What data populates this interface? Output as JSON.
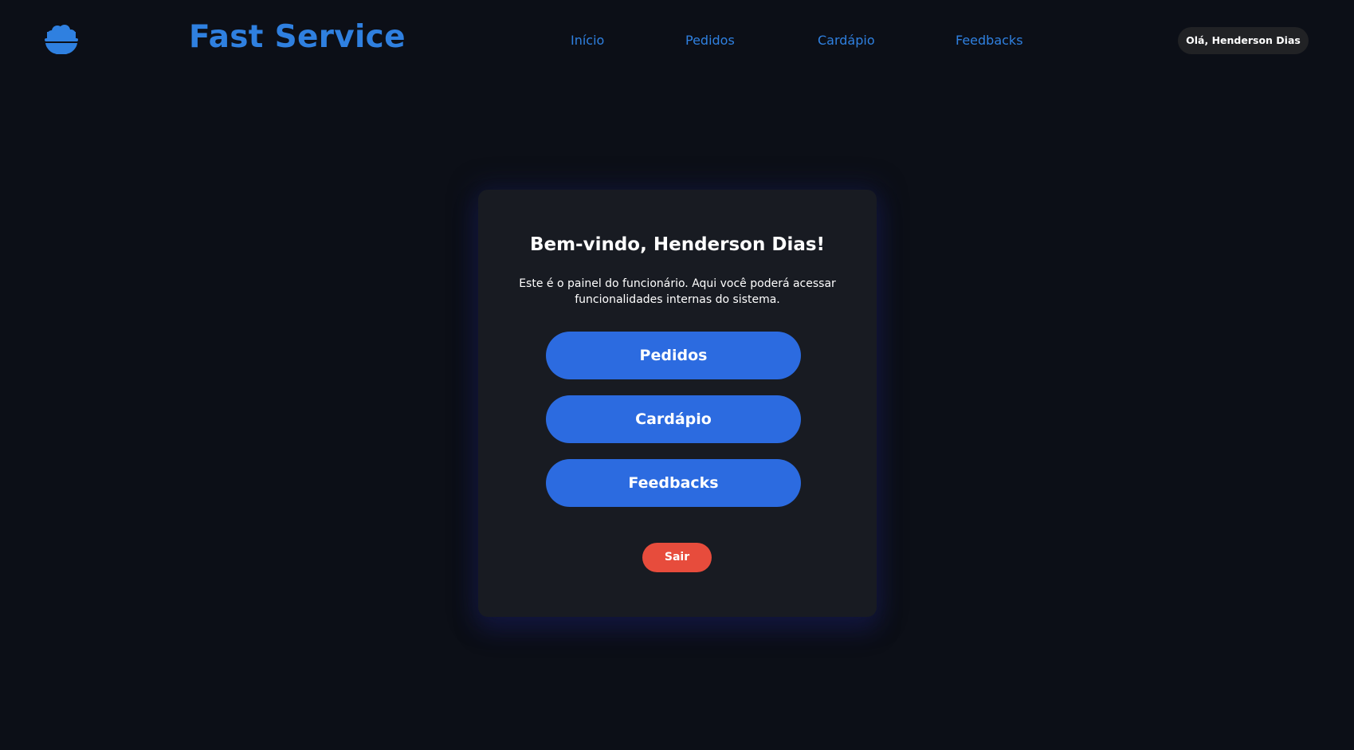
{
  "header": {
    "brand": "Fast Service",
    "logo_icon": "rice-bowl-icon",
    "nav": [
      {
        "label": "Início"
      },
      {
        "label": "Pedidos"
      },
      {
        "label": "Cardápio"
      },
      {
        "label": "Feedbacks"
      }
    ],
    "user_greeting": "Olá, Henderson Dias"
  },
  "panel": {
    "title": "Bem-vindo, Henderson Dias!",
    "description": "Este é o painel do funcionário. Aqui você poderá acessar funcionalidades internas do sistema.",
    "buttons": [
      {
        "label": "Pedidos"
      },
      {
        "label": "Cardápio"
      },
      {
        "label": "Feedbacks"
      }
    ],
    "logout_label": "Sair"
  },
  "colors": {
    "background": "#0c0f17",
    "panel": "#181b22",
    "accent": "#2f80e0",
    "button": "#2c6be0",
    "logout": "#e74c3c",
    "pill": "#212225"
  }
}
